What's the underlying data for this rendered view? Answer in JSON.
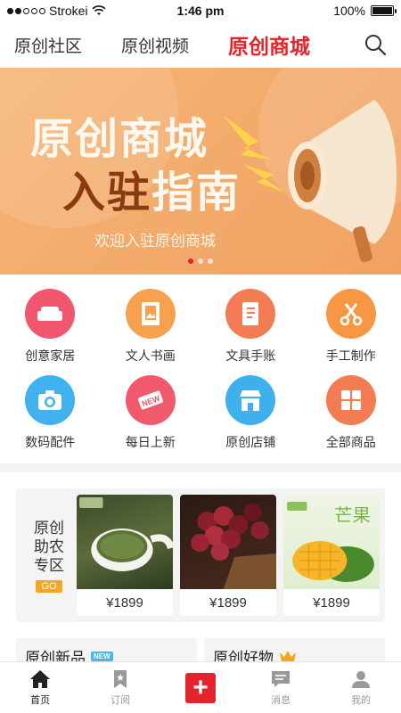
{
  "status_bar": {
    "carrier": "Strokei",
    "time": "1:46 pm",
    "battery": "100%",
    "battery_level": 1.0
  },
  "top_nav": {
    "tabs": [
      "原创社区",
      "原创视频",
      "原创商城"
    ],
    "active_tab": "原创商城"
  },
  "banner": {
    "title_line1": "原创商城",
    "title_line2_a": "入驻",
    "title_line2_b": "指南",
    "subtitle": "欢迎入驻原创商城",
    "pages": 3,
    "current_page": 1
  },
  "categories": [
    {
      "label": "创意家居",
      "icon": "sofa-icon",
      "color": "#f0566e"
    },
    {
      "label": "文人书画",
      "icon": "painting-icon",
      "color": "#f7a14e"
    },
    {
      "label": "文具手账",
      "icon": "notebook-icon",
      "color": "#f47c54"
    },
    {
      "label": "手工制作",
      "icon": "scissors-icon",
      "color": "#f89743"
    },
    {
      "label": "数码配件",
      "icon": "camera-icon",
      "color": "#3fb2ef"
    },
    {
      "label": "每日上新",
      "icon": "new-tag-icon",
      "color": "#f05a6c"
    },
    {
      "label": "原创店铺",
      "icon": "store-icon",
      "color": "#3fb0ee"
    },
    {
      "label": "全部商品",
      "icon": "grid-icon",
      "color": "#f47c54"
    }
  ],
  "farm_zone": {
    "title": "原创助农专区",
    "go_label": "GO",
    "products": [
      {
        "name": "tea",
        "price": "¥1899"
      },
      {
        "name": "grapes",
        "price": "¥1899"
      },
      {
        "name": "mango",
        "price": "¥1899"
      }
    ]
  },
  "sections": [
    {
      "title": "原创新品",
      "badge": "NEW"
    },
    {
      "title": "原创好物",
      "badge_icon": "crown-icon"
    }
  ],
  "tabbar": {
    "items": [
      {
        "label": "首页",
        "icon": "home-icon",
        "active": true
      },
      {
        "label": "订阅",
        "icon": "bookmark-icon",
        "active": false
      },
      {
        "label": "",
        "icon": "plus-icon",
        "active": false
      },
      {
        "label": "消息",
        "icon": "message-icon",
        "active": false
      },
      {
        "label": "我的",
        "icon": "profile-icon",
        "active": false
      }
    ]
  },
  "colors": {
    "accent": "#e5232c",
    "banner_bg": "#f6b475",
    "go_badge": "#f5a623"
  }
}
